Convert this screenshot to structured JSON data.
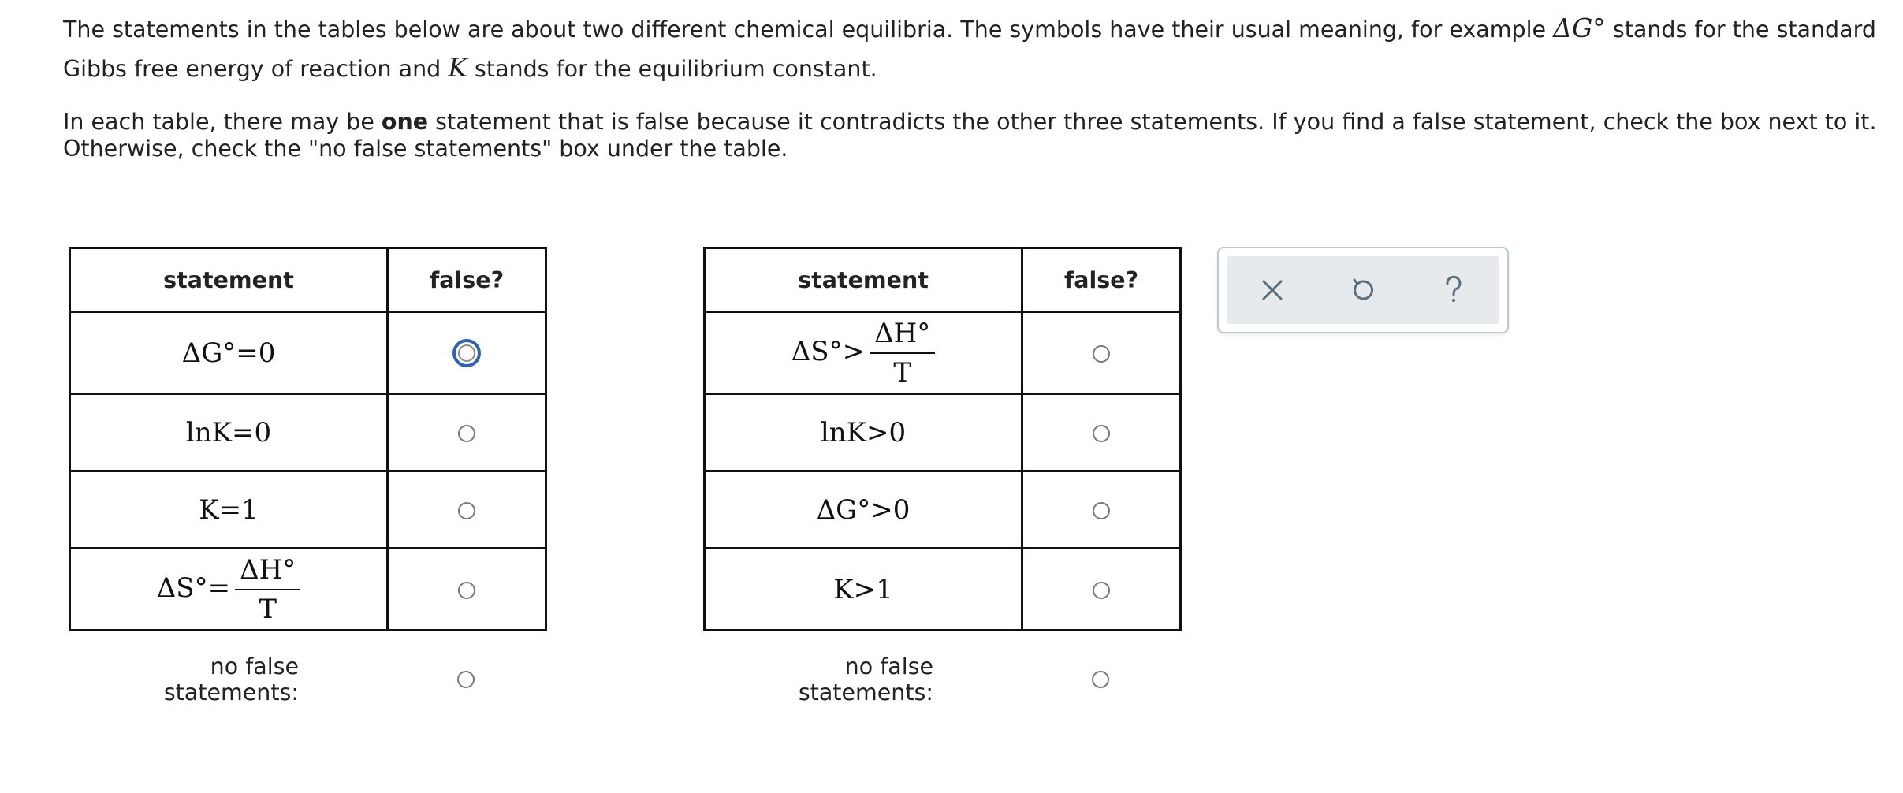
{
  "intro": {
    "p1_a": "The statements in the tables below are about two different chemical equilibria. The symbols have their usual meaning, for example ",
    "p1_sym_g": "ΔG°",
    "p1_b": " stands for the standard Gibbs free energy of reaction and ",
    "p1_sym_k": "K",
    "p1_c": " stands for the equilibrium constant.",
    "p2_a": "In each table, there may be ",
    "p2_bold": "one",
    "p2_b": " statement that is false because it contradicts the other three statements. If you find a false statement, check the box next to it. Otherwise, check the \"no false statements\" box under the table."
  },
  "headers": {
    "statement": "statement",
    "false": "false?"
  },
  "table1": {
    "s1": "ΔG°=0",
    "s2": "lnK=0",
    "s3": "K=1",
    "s4_left": "ΔS°=",
    "s4_num": "ΔH°",
    "s4_den": "T"
  },
  "table2": {
    "s1_left": "ΔS°>",
    "s1_num": "ΔH°",
    "s1_den": "T",
    "s2": "lnK>0",
    "s3": "ΔG°>0",
    "s4": "K>1"
  },
  "no_false_label": "no false statements:",
  "toolbar": {
    "close_icon": "close-icon",
    "undo_icon": "undo-icon",
    "help_icon": "help-icon"
  },
  "colors": {
    "focus": "#2f63b3",
    "toolbar_bg": "#e6eaed",
    "toolbar_border": "#b9c9d6",
    "icon": "#5a6f7d"
  }
}
